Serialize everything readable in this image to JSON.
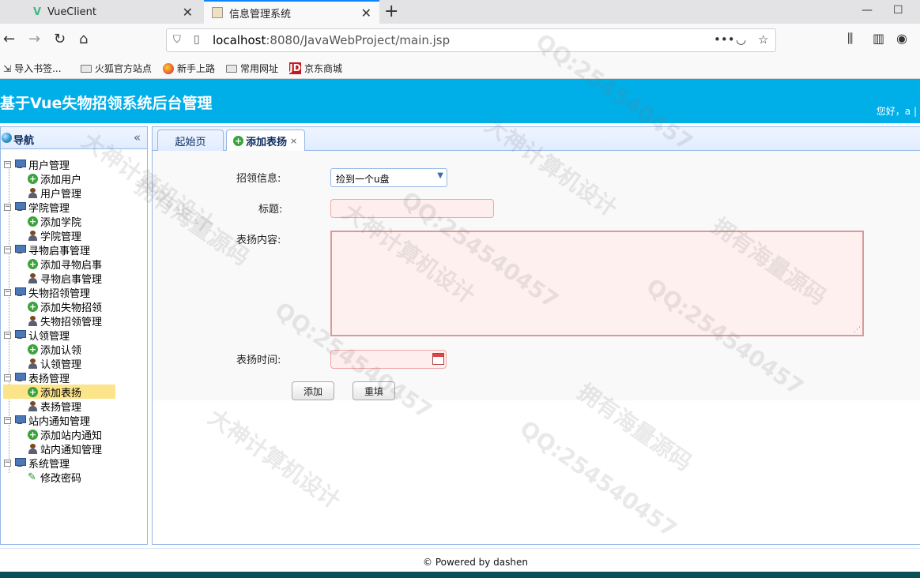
{
  "browser": {
    "tabs": [
      {
        "title": "VueClient"
      },
      {
        "title": "信息管理系统"
      }
    ],
    "url_host": "localhost",
    "url_rest": ":8080/JavaWebProject/main.jsp",
    "bookmarks": [
      "导入书签...",
      "火狐官方站点",
      "新手上路",
      "常用网址",
      "京东商城"
    ],
    "jd_badge": "JD"
  },
  "header": {
    "title": "基于Vue失物招领系统后台管理",
    "greeting": "您好，a |"
  },
  "sidebar": {
    "title": "导航",
    "groups": [
      {
        "label": "用户管理",
        "items": [
          {
            "label": "添加用户",
            "icon": "add-icon"
          },
          {
            "label": "用户管理",
            "icon": "user-icon"
          }
        ]
      },
      {
        "label": "学院管理",
        "items": [
          {
            "label": "添加学院",
            "icon": "add-icon"
          },
          {
            "label": "学院管理",
            "icon": "user-icon"
          }
        ]
      },
      {
        "label": "寻物启事管理",
        "items": [
          {
            "label": "添加寻物启事",
            "icon": "add-icon"
          },
          {
            "label": "寻物启事管理",
            "icon": "user-icon"
          }
        ]
      },
      {
        "label": "失物招领管理",
        "items": [
          {
            "label": "添加失物招领",
            "icon": "add-icon"
          },
          {
            "label": "失物招领管理",
            "icon": "user-icon"
          }
        ]
      },
      {
        "label": "认领管理",
        "items": [
          {
            "label": "添加认领",
            "icon": "add-icon"
          },
          {
            "label": "认领管理",
            "icon": "user-icon"
          }
        ]
      },
      {
        "label": "表扬管理",
        "items": [
          {
            "label": "添加表扬",
            "icon": "add-icon"
          },
          {
            "label": "表扬管理",
            "icon": "user-icon"
          }
        ]
      },
      {
        "label": "站内通知管理",
        "items": [
          {
            "label": "添加站内通知",
            "icon": "add-icon"
          },
          {
            "label": "站内通知管理",
            "icon": "user-icon"
          }
        ]
      },
      {
        "label": "系统管理",
        "items": [
          {
            "label": "修改密码",
            "icon": "pen-icon"
          }
        ]
      }
    ]
  },
  "main": {
    "tabs": [
      {
        "label": "起始页"
      },
      {
        "label": "添加表扬"
      }
    ],
    "form": {
      "info_label": "招领信息:",
      "info_selected": "捡到一个u盘",
      "title_label": "标题:",
      "content_label": "表扬内容:",
      "time_label": "表扬时间:",
      "add_button": "添加",
      "reset_button": "重填"
    }
  },
  "footer": {
    "text": "© Powered by dashen"
  },
  "watermarks": {
    "a": "大神计算机设计",
    "b": "QQ:254540457",
    "c": "拥有海量源码"
  }
}
